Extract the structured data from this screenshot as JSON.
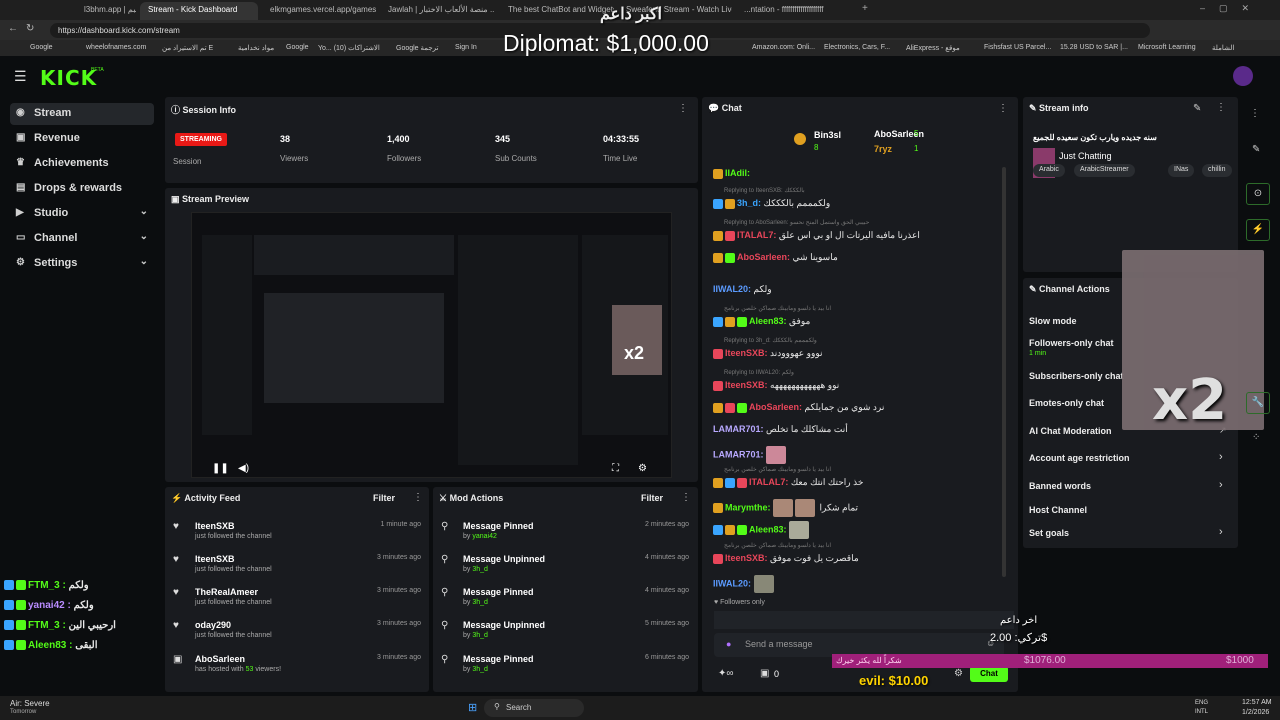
{
  "browser": {
    "tabs": [
      "l3bhm.app | البيبم",
      "Stream - Kick Dashboard",
      "elkmgames.vercel.app/games/wh...",
      "Jawlah | منصة الألعاب الاختبار ...",
      "The best ChatBot and Widgets ...",
      "Sweafend Stream - Watch Live...",
      "...ntation - ffffffffffffffffffff"
    ],
    "url": "https://dashboard.kick.com/stream",
    "bookmarks": [
      "Google",
      "wheelofnames.com",
      "تم الاستيراد من E",
      "مواد نخدامية",
      "Google",
      "Yo... (10) الاشتراكات",
      "Google ترجمة",
      "Sign In",
      "Amazon.com: Onli...",
      "Electronics, Cars, F...",
      "AliExpress - موقع",
      "Fishsfast US Parcel...",
      "15.28 USD to SAR |...",
      "Microsoft Learning",
      "الشاملة"
    ]
  },
  "overlay_top": {
    "arabic": "اكبر داعم",
    "diplomat": "Diplomat: $1,000.00"
  },
  "brand": {
    "logo": "KICK",
    "beta": "BETA"
  },
  "sidebar": {
    "items": [
      {
        "label": "Stream",
        "icon": "stream-icon"
      },
      {
        "label": "Revenue",
        "icon": "revenue-icon"
      },
      {
        "label": "Achievements",
        "icon": "trophy-icon"
      },
      {
        "label": "Drops & rewards",
        "icon": "gift-icon"
      },
      {
        "label": "Studio",
        "icon": "studio-icon"
      },
      {
        "label": "Channel",
        "icon": "channel-icon"
      },
      {
        "label": "Settings",
        "icon": "gear-icon"
      }
    ]
  },
  "session": {
    "title": "Session Info",
    "status": "STREAMING",
    "status_label": "Session",
    "viewers": "38",
    "viewers_label": "Viewers",
    "followers": "1,400",
    "followers_label": "Followers",
    "subs": "345",
    "subs_label": "Sub Counts",
    "time": "04:33:55",
    "time_label": "Time Live"
  },
  "preview": {
    "title": "Stream Preview",
    "x2": "x2"
  },
  "activity": {
    "title": "Activity Feed",
    "filter": "Filter",
    "items": [
      {
        "name": "IteenSXB",
        "sub": "just followed the channel",
        "time": "1 minute ago"
      },
      {
        "name": "IteenSXB",
        "sub": "just followed the channel",
        "time": "3 minutes ago"
      },
      {
        "name": "TheRealAmeer",
        "sub": "just followed the channel",
        "time": "3 minutes ago"
      },
      {
        "name": "oday290",
        "sub": "just followed the channel",
        "time": "3 minutes ago"
      },
      {
        "name": "AboSarleen",
        "sub_pre": "has hosted with ",
        "sub_num": "53",
        "sub_post": " viewers!",
        "time": "3 minutes ago"
      }
    ]
  },
  "mod": {
    "title": "Mod Actions",
    "filter": "Filter",
    "items": [
      {
        "action": "Message Pinned",
        "by": "by ",
        "user": "yanai42",
        "time": "2 minutes ago"
      },
      {
        "action": "Message Unpinned",
        "by": "by ",
        "user": "3h_d",
        "time": "4 minutes ago"
      },
      {
        "action": "Message Pinned",
        "by": "by ",
        "user": "3h_d",
        "time": "4 minutes ago"
      },
      {
        "action": "Message Unpinned",
        "by": "by ",
        "user": "3h_d",
        "time": "5 minutes ago"
      },
      {
        "action": "Message Pinned",
        "by": "by ",
        "user": "3h_d",
        "time": "6 minutes ago"
      }
    ]
  },
  "chat": {
    "title": "Chat",
    "top_gifters": [
      {
        "name": "Bin3sl",
        "count": "8"
      },
      {
        "name": "AboSarleen",
        "count": "5"
      },
      {
        "name": "7ryz",
        "count": "1"
      }
    ],
    "messages": [
      {
        "reply": "",
        "user": "IIAdil:",
        "text": "",
        "color": "#53fc18"
      },
      {
        "reply": "Replying to IteenSXB: بالكككك",
        "user": "3h_d:",
        "text": "ولكمممم بالكككك",
        "color": "#3aa5ff"
      },
      {
        "reply": "Replying to AboSarleen: حبيبي الحق واستمل المنح نحسو",
        "user": "ITALAL7:",
        "text": "اعذرنا مافيه اليرتات ال او بي اس علق",
        "color": "#e8465a"
      },
      {
        "reply": "",
        "user": "AboSarleen:",
        "text": "ماسوينا شي",
        "color": "#e8465a"
      },
      {
        "reply": "",
        "user": "IIWAL20:",
        "text": "ولكم",
        "color": "#5b9bff"
      },
      {
        "reply": "انا بيد يا دلسو ومابينك صماكن خلصن برنامج",
        "user": "Aleen83:",
        "text": "موفق",
        "color": "#53fc18"
      },
      {
        "reply": "Replying to 3h_d: ولكمممم بالكككك",
        "user": "IteenSXB:",
        "text": "نووو عهووودند",
        "color": "#e8465a"
      },
      {
        "reply": "Replying to IIWAL20: ولكم",
        "user": "IteenSXB:",
        "text": "نوو ههههههههههههه",
        "color": "#e8465a"
      },
      {
        "reply": "",
        "user": "AboSarleen:",
        "text": "نرد شوي من جمايلكم",
        "color": "#e8465a"
      },
      {
        "reply": "",
        "user": "LAMAR701:",
        "text": "أنت مشاكلك ما تخلص",
        "color": "#b8a9ff"
      },
      {
        "reply": "",
        "user": "LAMAR701:",
        "text": "",
        "color": "#b8a9ff"
      },
      {
        "reply": "انا بيد يا دلسو ومابينك صماكن خلصن برنامج",
        "user": "ITALAL7:",
        "text": "خذ راحتك انتك معك",
        "color": "#e8465a"
      },
      {
        "reply": "",
        "user": "Marymthe:",
        "text": "تمام شكرا",
        "color": "#53fc18"
      },
      {
        "reply": "",
        "user": "Aleen83:",
        "text": "",
        "color": "#53fc18"
      },
      {
        "reply": "انا بيد يا دلسو ومابينك صماكن خلصن برنامج",
        "user": "IteenSXB:",
        "text": "ماقصرت يل فوت موفق",
        "color": "#e8465a"
      },
      {
        "reply": "",
        "user": "IIWAL20:",
        "text": "",
        "color": "#5b9bff"
      }
    ],
    "followers_only": "Followers only",
    "placeholder": "Send a message",
    "points": "0",
    "send": "Chat"
  },
  "stream_info": {
    "title": "Stream info",
    "name": "سنه جديده ويارب تكون سعيده للجميع",
    "category": "Just Chatting",
    "tags": [
      "Arabic",
      "ArabicStreamer",
      "INas",
      "chillin"
    ]
  },
  "channel_actions": {
    "title": "Channel Actions",
    "items": [
      "Slow mode",
      "Followers-only chat",
      "Subscribers-only chat",
      "Emotes-only chat",
      "AI Chat Moderation",
      "Account age restriction",
      "Banned words",
      "Host Channel",
      "Set goals"
    ],
    "followers_only_sub": "1 min"
  },
  "overlay_webcam": {
    "x2": "x2"
  },
  "overlay_chat": [
    {
      "user": "FTM_3 :",
      "text": "ولكم",
      "color": "#53fc18"
    },
    {
      "user": "yanai42 :",
      "text": "ولكم",
      "color": "#b98cff"
    },
    {
      "user": "FTM_3 :",
      "text": "ارحيبي الين",
      "color": "#53fc18"
    },
    {
      "user": "Aleen83 :",
      "text": "البقى",
      "color": "#53fc18"
    }
  ],
  "overlay_bottom": {
    "last": "اخر داعم",
    "turki": "تركي: 2.00$",
    "goal_text": "شكراً لله يكثر خيرك",
    "goal_current": "$1076.00",
    "goal_max": "$1000",
    "evil": "evil: $10.00"
  },
  "taskbar": {
    "weather": "Air: Severe",
    "weather_sub": "Tomorrow",
    "search": "Search",
    "lang": "ENG",
    "lang_sub": "INTL",
    "time": "12:57 AM",
    "date": "1/2/2026"
  }
}
